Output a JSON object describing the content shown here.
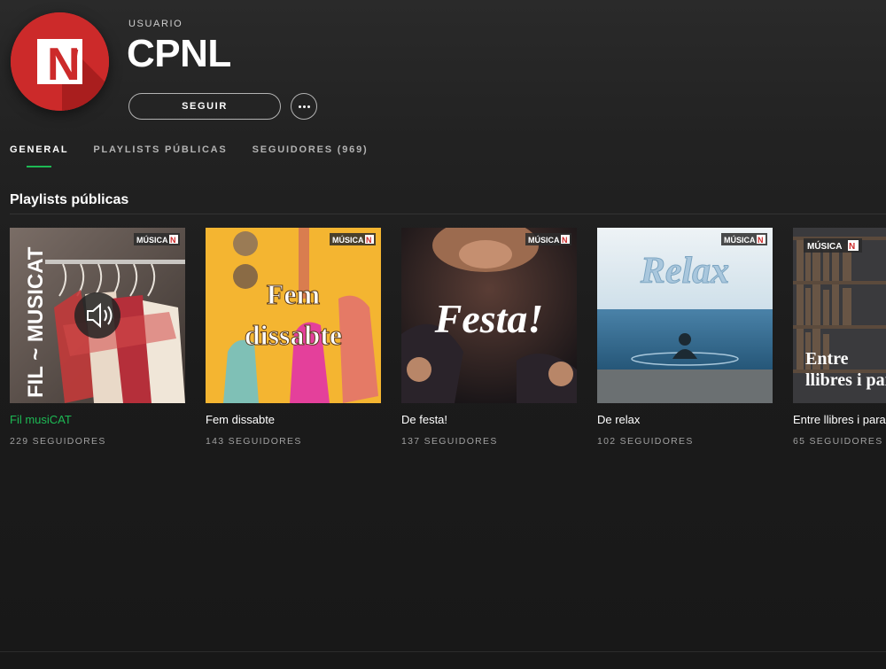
{
  "profile": {
    "kind_label": "USUARIO",
    "name": "CPNL",
    "follow_label": "SEGUIR",
    "more_icon": "ellipsis-icon",
    "avatar_letters": "N",
    "avatar_script": "l"
  },
  "tabs": [
    {
      "label": "GENERAL",
      "active": true
    },
    {
      "label": "PLAYLISTS PÚBLICAS",
      "active": false
    },
    {
      "label": "SEGUIDORES (969)",
      "active": false
    }
  ],
  "section": {
    "title": "Playlists públicas"
  },
  "badge": {
    "text": "MÚSICA",
    "mark": "N"
  },
  "playlists": [
    {
      "title": "Fil musiCAT",
      "followers": "229 SEGUIDORES",
      "cover_text": "FIL ~ MUSICAT",
      "playing": true
    },
    {
      "title": "Fem dissabte",
      "followers": "143 SEGUIDORES",
      "cover_line1": "Fem",
      "cover_line2": "dissabte",
      "playing": false
    },
    {
      "title": "De festa!",
      "followers": "137 SEGUIDORES",
      "cover_text": "Festa!",
      "playing": false
    },
    {
      "title": "De relax",
      "followers": "102 SEGUIDORES",
      "cover_text": "Relax",
      "playing": false
    },
    {
      "title": "Entre llibres i paraules",
      "followers": "65 SEGUIDORES",
      "cover_line1": "Entre",
      "cover_line2": "llibres i paraules",
      "playing": false
    }
  ],
  "colors": {
    "accent": "#1db954",
    "avatar_red": "#cc2a2a",
    "background": "#181818"
  }
}
